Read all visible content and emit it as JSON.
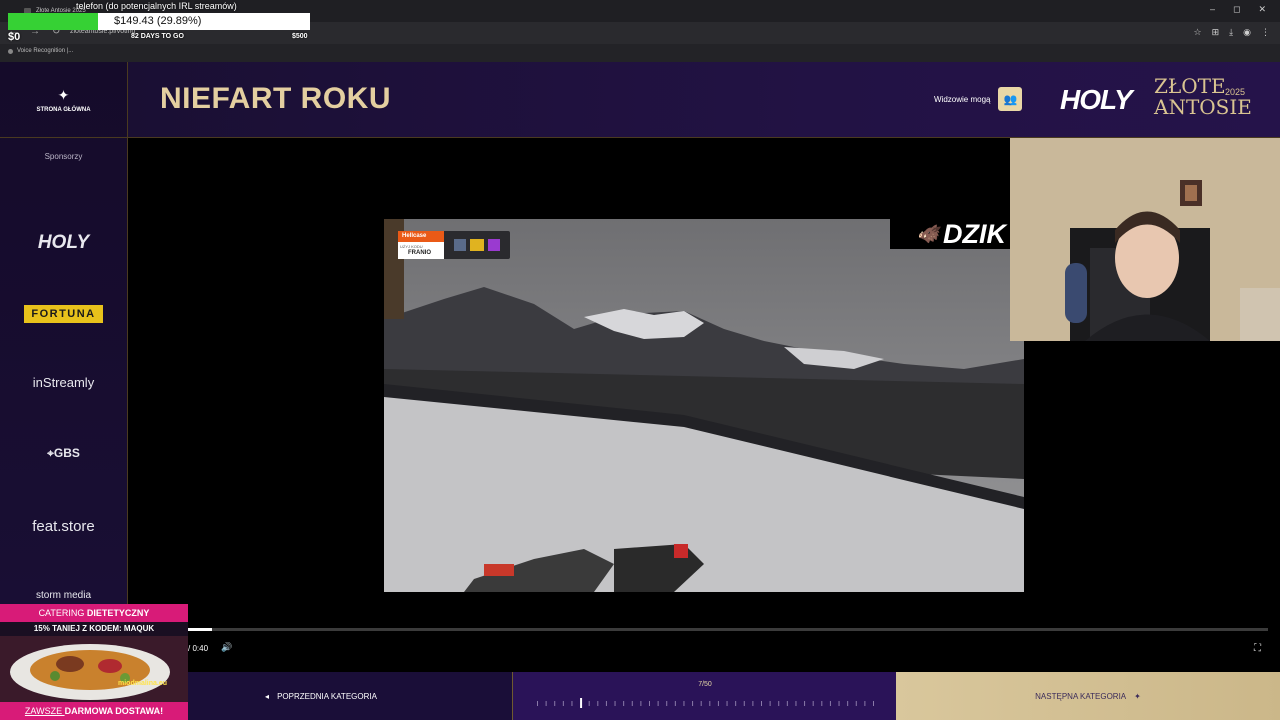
{
  "browser": {
    "tab_title": "Złote Antosie 2025",
    "url": "zloteantosie.pl/voting",
    "bookmark": "Voice Recognition |..."
  },
  "overlay": {
    "title": "telefon (do potencjalnych IRL streamów)",
    "progress_text": "$149.43 (29.89%)",
    "progress_fraction": 0.2989,
    "start_label": "$0",
    "days_label": "82 DAYS TO GO",
    "goal_label": "$500"
  },
  "sidebar": {
    "home_label": "STRONA GŁÓWNA",
    "sponsors_title": "Sponsorzy",
    "sponsors": [
      "HOLY",
      "FORTUNA",
      "inStreamly",
      "GBS",
      "feat.store",
      "storm media"
    ]
  },
  "header": {
    "title": "NIEFART ROKU",
    "viewers_label": "Widzowie mogą",
    "logo_holy": "HOLY",
    "logo_line1": "ZŁOTE",
    "logo_line2": "ANTOSIE",
    "logo_year": "2025"
  },
  "video": {
    "hellcase_brand": "Hellcase",
    "hellcase_sub": "UŻYJ KODU",
    "hellcase_code": "FRANIO",
    "dzik": "DZIK",
    "time": "/ 0:40",
    "progress_fraction": 0.022
  },
  "footer": {
    "prev_label": "POPRZEDNIA KATEGORIA",
    "counter": "7/50",
    "next_label": "NASTĘPNA KATEGORIA"
  },
  "ad": {
    "line1_a": "CATERING ",
    "line1_b": "DIETETYCZNY",
    "line2": "15% TANIEJ Z KODEM: MAQUK",
    "line3_a": "ZAWSZE ",
    "line3_b": "DARMOWA DOSTAWA!",
    "brand": "miodmalina.eu"
  },
  "colors": {
    "accent_gold": "#e4cfa0",
    "purple": "#1a0e38",
    "progress_green": "#36d134",
    "ad_pink": "#d81b78"
  }
}
